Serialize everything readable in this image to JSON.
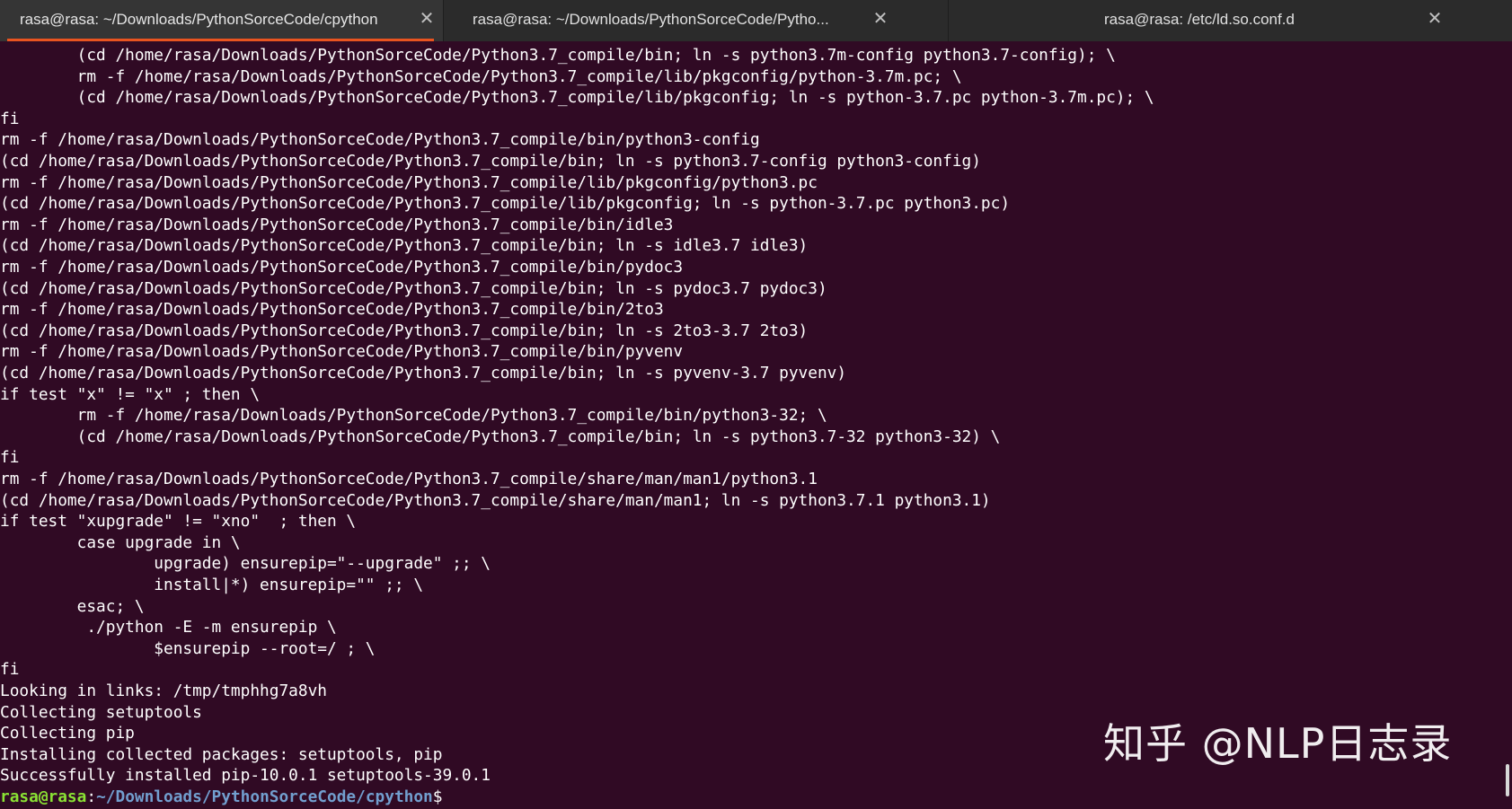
{
  "tabs": [
    {
      "title": "rasa@rasa: ~/Downloads/PythonSorceCode/cpython",
      "close": "✕",
      "active": true
    },
    {
      "title": "rasa@rasa: ~/Downloads/PythonSorceCode/Pytho...",
      "close": "✕",
      "active": false
    },
    {
      "title": "rasa@rasa: /etc/ld.so.conf.d",
      "close": "✕",
      "active": false
    }
  ],
  "terminal": {
    "lines": [
      "        (cd /home/rasa/Downloads/PythonSorceCode/Python3.7_compile/bin; ln -s python3.7m-config python3.7-config); \\",
      "        rm -f /home/rasa/Downloads/PythonSorceCode/Python3.7_compile/lib/pkgconfig/python-3.7m.pc; \\",
      "        (cd /home/rasa/Downloads/PythonSorceCode/Python3.7_compile/lib/pkgconfig; ln -s python-3.7.pc python-3.7m.pc); \\",
      "fi",
      "rm -f /home/rasa/Downloads/PythonSorceCode/Python3.7_compile/bin/python3-config",
      "(cd /home/rasa/Downloads/PythonSorceCode/Python3.7_compile/bin; ln -s python3.7-config python3-config)",
      "rm -f /home/rasa/Downloads/PythonSorceCode/Python3.7_compile/lib/pkgconfig/python3.pc",
      "(cd /home/rasa/Downloads/PythonSorceCode/Python3.7_compile/lib/pkgconfig; ln -s python-3.7.pc python3.pc)",
      "rm -f /home/rasa/Downloads/PythonSorceCode/Python3.7_compile/bin/idle3",
      "(cd /home/rasa/Downloads/PythonSorceCode/Python3.7_compile/bin; ln -s idle3.7 idle3)",
      "rm -f /home/rasa/Downloads/PythonSorceCode/Python3.7_compile/bin/pydoc3",
      "(cd /home/rasa/Downloads/PythonSorceCode/Python3.7_compile/bin; ln -s pydoc3.7 pydoc3)",
      "rm -f /home/rasa/Downloads/PythonSorceCode/Python3.7_compile/bin/2to3",
      "(cd /home/rasa/Downloads/PythonSorceCode/Python3.7_compile/bin; ln -s 2to3-3.7 2to3)",
      "rm -f /home/rasa/Downloads/PythonSorceCode/Python3.7_compile/bin/pyvenv",
      "(cd /home/rasa/Downloads/PythonSorceCode/Python3.7_compile/bin; ln -s pyvenv-3.7 pyvenv)",
      "if test \"x\" != \"x\" ; then \\",
      "        rm -f /home/rasa/Downloads/PythonSorceCode/Python3.7_compile/bin/python3-32; \\",
      "        (cd /home/rasa/Downloads/PythonSorceCode/Python3.7_compile/bin; ln -s python3.7-32 python3-32) \\",
      "fi",
      "rm -f /home/rasa/Downloads/PythonSorceCode/Python3.7_compile/share/man/man1/python3.1",
      "(cd /home/rasa/Downloads/PythonSorceCode/Python3.7_compile/share/man/man1; ln -s python3.7.1 python3.1)",
      "if test \"xupgrade\" != \"xno\"  ; then \\",
      "        case upgrade in \\",
      "                upgrade) ensurepip=\"--upgrade\" ;; \\",
      "                install|*) ensurepip=\"\" ;; \\",
      "        esac; \\",
      "         ./python -E -m ensurepip \\",
      "                $ensurepip --root=/ ; \\",
      "fi",
      "Looking in links: /tmp/tmphhg7a8vh",
      "Collecting setuptools",
      "Collecting pip",
      "Installing collected packages: setuptools, pip",
      "Successfully installed pip-10.0.1 setuptools-39.0.1"
    ],
    "prompt": {
      "user_host": "rasa@rasa",
      "separator": ":",
      "path": "~/Downloads/PythonSorceCode/cpython",
      "symbol": "$"
    }
  },
  "watermark": "知乎 @NLP日志录",
  "colors": {
    "terminal_bg": "#300a24",
    "tab_bar_bg": "#2b2b2b",
    "accent": "#e95420",
    "prompt_user": "#8ae234",
    "prompt_path": "#729fcf"
  }
}
